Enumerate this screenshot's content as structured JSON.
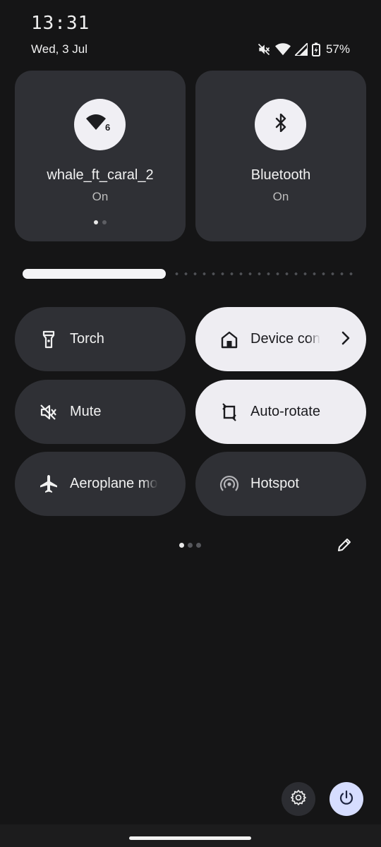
{
  "status": {
    "time": "13:31",
    "date": "Wed, 3 Jul",
    "battery_percent": "57%",
    "icons": [
      "mute-icon",
      "wifi-icon",
      "cellular-signal-icon",
      "battery-charging-icon"
    ]
  },
  "big_tiles": [
    {
      "title": "whale_ft_caral_2",
      "state": "On",
      "icon": "wifi-6-icon",
      "badge": "6"
    },
    {
      "title": "Bluetooth",
      "state": "On",
      "icon": "bluetooth-icon"
    }
  ],
  "big_tile_pager": {
    "count": 2,
    "active": 0
  },
  "brightness": {
    "level_percent": 43
  },
  "quick_tiles": [
    {
      "label": "Torch",
      "icon": "torch-icon",
      "active": false
    },
    {
      "label": "Device con",
      "icon": "home-icon",
      "active": true,
      "has_chevron": true
    },
    {
      "label": "Mute",
      "icon": "mute-icon",
      "active": false
    },
    {
      "label": "Auto-rotate",
      "icon": "auto-rotate-icon",
      "active": true
    },
    {
      "label": "Aeroplane mo",
      "icon": "airplane-icon",
      "active": false
    },
    {
      "label": "Hotspot",
      "icon": "hotspot-icon",
      "active": false
    }
  ],
  "tile_pager": {
    "count": 3,
    "active": 0
  },
  "actions": {
    "edit_icon": "pencil-icon",
    "settings_icon": "gear-icon",
    "power_icon": "power-icon"
  },
  "colors": {
    "background": "#151516",
    "tile": "#2f3035",
    "tile_active": "#eeedf2",
    "power_button": "#d6ddff"
  }
}
